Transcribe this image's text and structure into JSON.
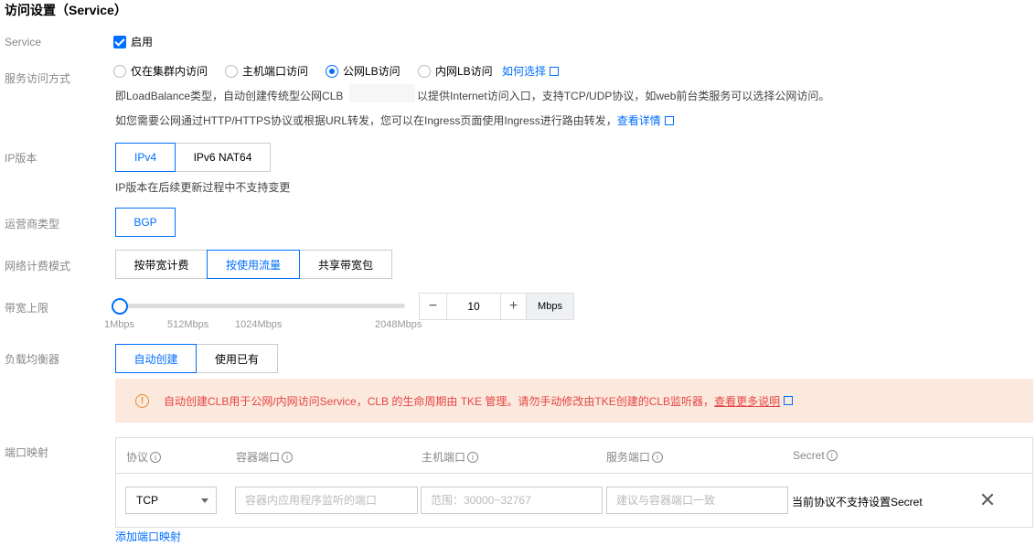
{
  "title": "访问设置（Service）",
  "labels": {
    "service": "Service",
    "access_mode": "服务访问方式",
    "ip_version": "IP版本",
    "isp": "运营商类型",
    "billing": "网络计费模式",
    "bandwidth": "带宽上限",
    "lb": "负载均衡器",
    "port_map": "端口映射"
  },
  "service": {
    "enable_label": "启用",
    "checked": true
  },
  "access_modes": [
    {
      "label": "仅在集群内访问",
      "selected": false
    },
    {
      "label": "主机端口访问",
      "selected": false
    },
    {
      "label": "公网LB访问",
      "selected": true
    },
    {
      "label": "内网LB访问",
      "selected": false
    }
  ],
  "how_to_choose": "如何选择",
  "desc1a": "即LoadBalance类型，自动创建传统型公网CLB",
  "desc1b": "以提供Internet访问入口，支持TCP/UDP协议，如web前台类服务可以选择公网访问。",
  "desc2": "如您需要公网通过HTTP/HTTPS协议或根据URL转发，您可以在Ingress页面使用Ingress进行路由转发，",
  "see_details": "查看详情",
  "ip_options": [
    "IPv4",
    "IPv6 NAT64"
  ],
  "ip_hint": "IP版本在后续更新过程中不支持变更",
  "isp_options": [
    "BGP"
  ],
  "billing_options": [
    "按带宽计费",
    "按使用流量",
    "共享带宽包"
  ],
  "bandwidth": {
    "ticks": [
      "1Mbps",
      "512Mbps",
      "1024Mbps",
      "2048Mbps"
    ],
    "value": "10",
    "unit": "Mbps",
    "minus": "−",
    "plus": "+"
  },
  "lb_options": [
    "自动创建",
    "使用已有"
  ],
  "warning": {
    "text": "自动创建CLB用于公网/内网访问Service，CLB 的生命周期由 TKE 管理。请勿手动修改由TKE创建的CLB监听器，",
    "link": "查看更多说明"
  },
  "port_table": {
    "headers": [
      "协议",
      "容器端口",
      "主机端口",
      "服务端口",
      "Secret"
    ],
    "protocol": "TCP",
    "container_port_placeholder": "容器内应用程序监听的端口",
    "host_port_placeholder": "范围：30000~32767",
    "service_port_placeholder": "建议与容器端口一致",
    "secret_text": "当前协议不支持设置Secret"
  },
  "add_port": "添加端口映射",
  "colors": {
    "accent": "#006eff",
    "warn_bg": "#fce9dd",
    "warn_text": "#e54545"
  }
}
